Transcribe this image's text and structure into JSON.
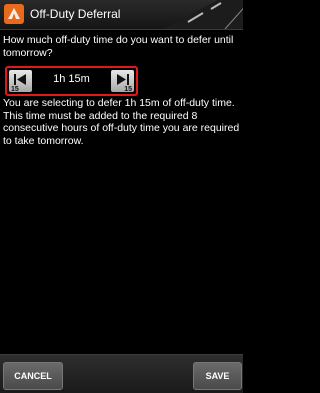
{
  "window": {
    "title": "Off-Duty Deferral",
    "icon": "app-icon"
  },
  "main": {
    "question": "How much off-duty time do you want to defer until tomorrow?",
    "stepper": {
      "value": "1h 15m",
      "decrement_step": "15",
      "increment_step": "15",
      "decrement_icon": "skip-back-icon",
      "increment_icon": "skip-forward-icon"
    },
    "info": "You are selecting to defer 1h 15m of off-duty time. This time must be added to the required 8 consecutive hours of off-duty time you are required to take tomorrow."
  },
  "actions": {
    "cancel_label": "CANCEL",
    "save_label": "SAVE"
  },
  "colors": {
    "accent": "#e01a1a",
    "icon": "#e86a1c",
    "background": "#000000",
    "text": "#ffffff"
  }
}
